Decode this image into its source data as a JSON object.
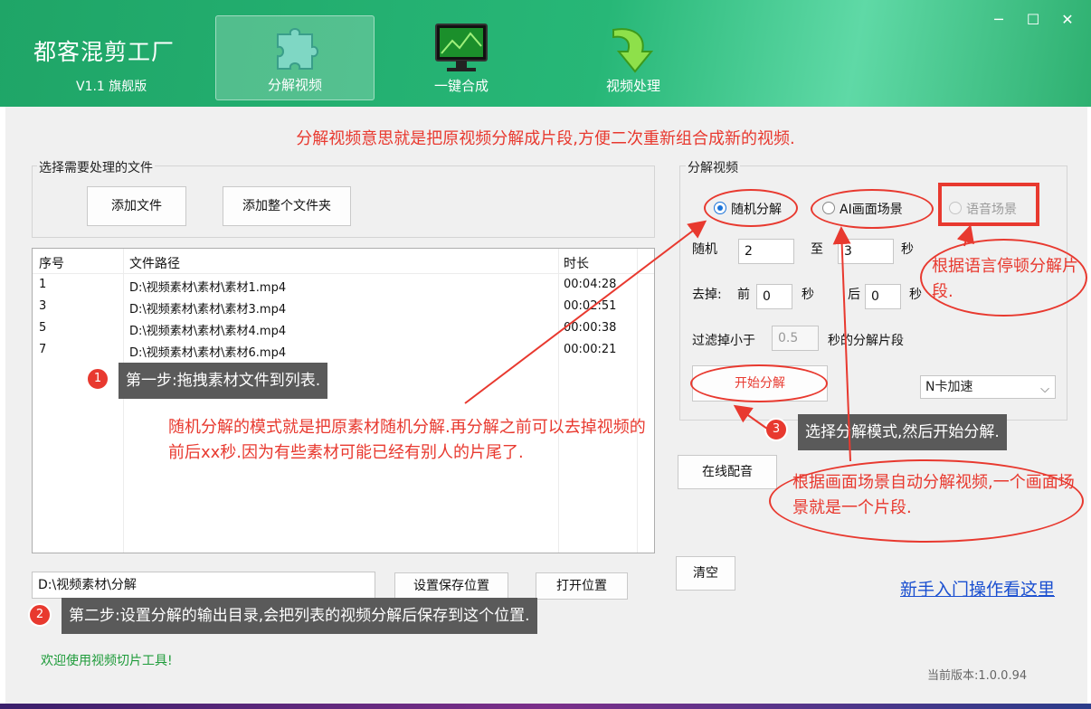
{
  "app": {
    "title": "都客混剪工厂",
    "version": "V1.1 旗舰版"
  },
  "nav": {
    "tabs": [
      {
        "label": "分解视频",
        "icon": "puzzle-icon"
      },
      {
        "label": "一键合成",
        "icon": "monitor-icon"
      },
      {
        "label": "视频处理",
        "icon": "arrow-down-icon"
      }
    ]
  },
  "window": {
    "minimize": "─",
    "maximize": "☐",
    "close": "✕"
  },
  "description": "分解视频意思就是把原视频分解成片段,方便二次重新组合成新的视频.",
  "file_group": {
    "title": "选择需要处理的文件",
    "add_file": "添加文件",
    "add_folder": "添加整个文件夹"
  },
  "table": {
    "columns": [
      "序号",
      "文件路径",
      "时长"
    ],
    "rows": [
      {
        "index": "1",
        "path": "D:\\视频素材\\素材\\素材1.mp4",
        "duration": "00:04:28"
      },
      {
        "index": "3",
        "path": "D:\\视频素材\\素材\\素材3.mp4",
        "duration": "00:02:51"
      },
      {
        "index": "5",
        "path": "D:\\视频素材\\素材\\素材4.mp4",
        "duration": "00:00:38"
      },
      {
        "index": "7",
        "path": "D:\\视频素材\\素材\\素材6.mp4",
        "duration": "00:00:21"
      }
    ]
  },
  "output": {
    "path": "D:\\视频素材\\分解",
    "set_location": "设置保存位置",
    "open_location": "打开位置"
  },
  "split_group": {
    "title": "分解视频",
    "mode_random": "随机分解",
    "mode_ai": "AI画面场景",
    "mode_voice": "语音场景",
    "random_label": "随机",
    "random_from": "2",
    "to_label": "至",
    "random_to": "3",
    "sec": "秒",
    "remove_label": "去掉:",
    "front_label": "前",
    "front_value": "0",
    "back_label": "后",
    "back_value": "0",
    "filter_label": "过滤掉小于",
    "filter_value": "0.5",
    "filter_suffix": "秒的分解片段",
    "start": "开始分解",
    "accel": "N卡加速"
  },
  "online_dub": "在线配音",
  "clear": "清空",
  "help_link": "新手入门操作看这里",
  "welcome": "欢迎使用视频切片工具!",
  "current_version": "当前版本:1.0.0.94",
  "annotations": {
    "step1": "第一步:拖拽素材文件到列表.",
    "step2": "第二步:设置分解的输出目录,会把列表的视频分解后保存到这个位置.",
    "step3": "选择分解模式,然后开始分解.",
    "random_note": "随机分解的模式就是把原素材随机分解.再分解之前可以去掉视频的前后xx秒.因为有些素材可能已经有别人的片尾了.",
    "voice_note": "根据语言停顿分解片段.",
    "ai_note": "根据画面场景自动分解视频,一个画面场景就是一个片段.",
    "badge1": "1",
    "badge2": "2",
    "badge3": "3"
  },
  "colors": {
    "header_green": "#27b777",
    "annotation_red": "#e8392f",
    "link_blue": "#1a4fd0",
    "welcome_green": "#1e9b3a"
  }
}
